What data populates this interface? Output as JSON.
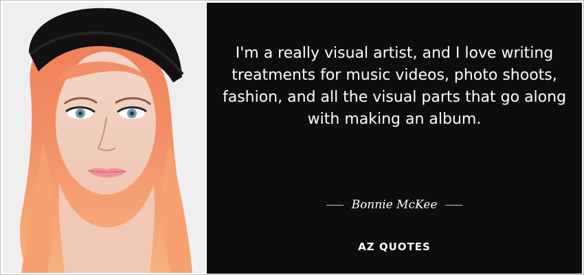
{
  "quote": {
    "text": "I'm a really visual artist, and I love writing treatments for music videos, photo shoots, fashion, and all the visual parts that go along with making an album.",
    "author": "Bonnie McKee"
  },
  "brand": {
    "name": "AZ QUOTES"
  },
  "image": {
    "subject": "portrait-photo"
  },
  "colors": {
    "panel": "#0d0d0d",
    "text": "#ffffff",
    "hair": "#f18b62",
    "cap": "#121212",
    "lips": "#f18fa0"
  }
}
